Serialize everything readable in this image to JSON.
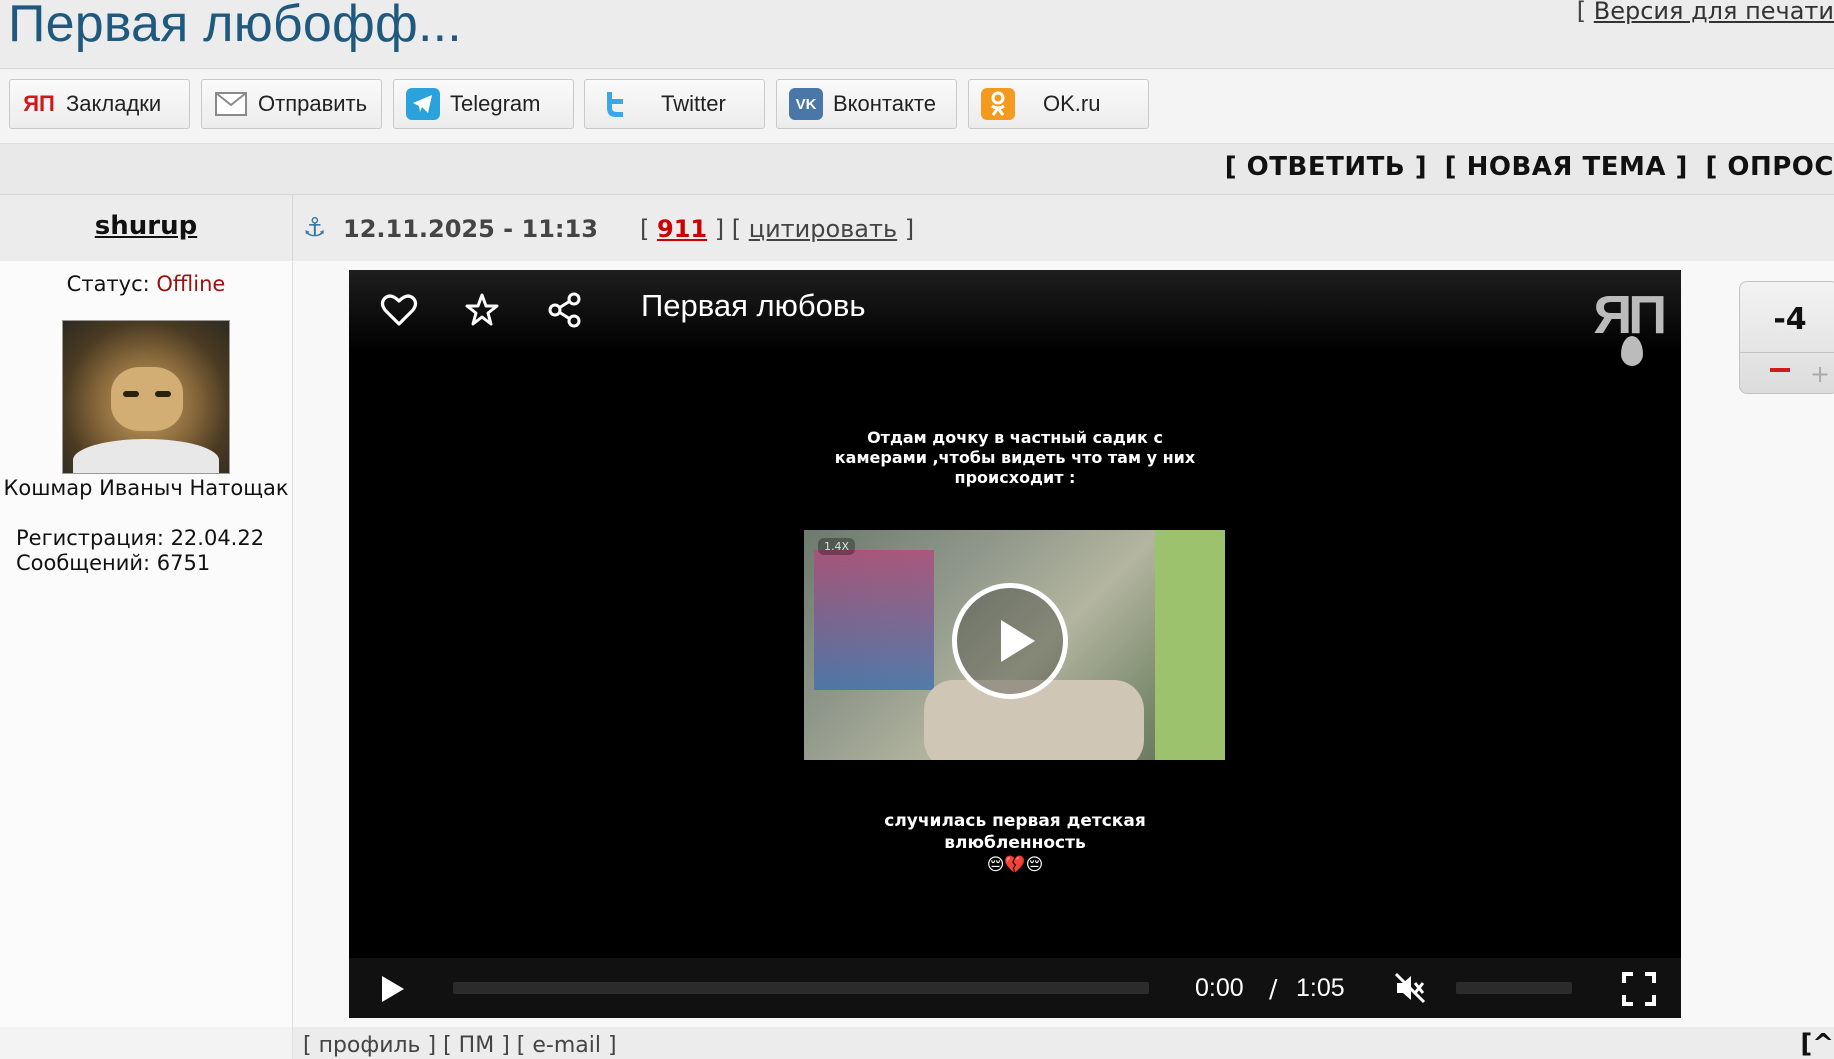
{
  "page": {
    "title": "Первая любофф...",
    "print_prefix": "[ ",
    "print_label": "Версия для печати"
  },
  "share": [
    {
      "label": "Закладки",
      "icon": "yap-icon",
      "color": "#d01818"
    },
    {
      "label": "Отправить",
      "icon": "mail-icon",
      "color": "#888888"
    },
    {
      "label": "Telegram",
      "icon": "telegram-icon",
      "color": "#2aa3dc"
    },
    {
      "label": "Twitter",
      "icon": "twitter-icon",
      "color": "#3aa8e6"
    },
    {
      "label": "Вконтакте",
      "icon": "vk-icon",
      "color": "#4a76a8"
    },
    {
      "label": "OK.ru",
      "icon": "ok-icon",
      "color": "#f39a1f"
    }
  ],
  "actions": {
    "reply": "[ ОТВЕТИТЬ ]",
    "new_topic": "[ НОВАЯ ТЕМА ]",
    "poll": "[ ОПРОС"
  },
  "post": {
    "username": "shurup",
    "date": "12.11.2025 - 11:13",
    "bracket_open": "[ ",
    "number": "911",
    "bracket_mid": " ] [ ",
    "quote": "цитировать",
    "bracket_close": " ]"
  },
  "user": {
    "status_label": "Статус:",
    "status_value": "Offline",
    "nickname": "Кошмар Иваныч Натощак",
    "registration": "Регистрация: 22.04.22",
    "messages": "Сообщений: 6751"
  },
  "video": {
    "title": "Первая любовь",
    "logo": "ЯП",
    "caption_top": "Отдам дочку в частный садик с камерами ,чтобы видеть что там у них происходит :",
    "speed": "1.4X",
    "caption_bottom": "случилась первая детская влюбленность",
    "emoji": "😔💔😔",
    "time_current": "0:00",
    "time_separator": "/",
    "time_duration": "1:05",
    "progress": 0
  },
  "rating": {
    "value": "-4",
    "minus_color": "#d31a1a"
  },
  "footer": {
    "profile": "[ профиль ]",
    "pm": "[ ПМ ]",
    "email": "[ e-mail ]",
    "top": "[^"
  }
}
